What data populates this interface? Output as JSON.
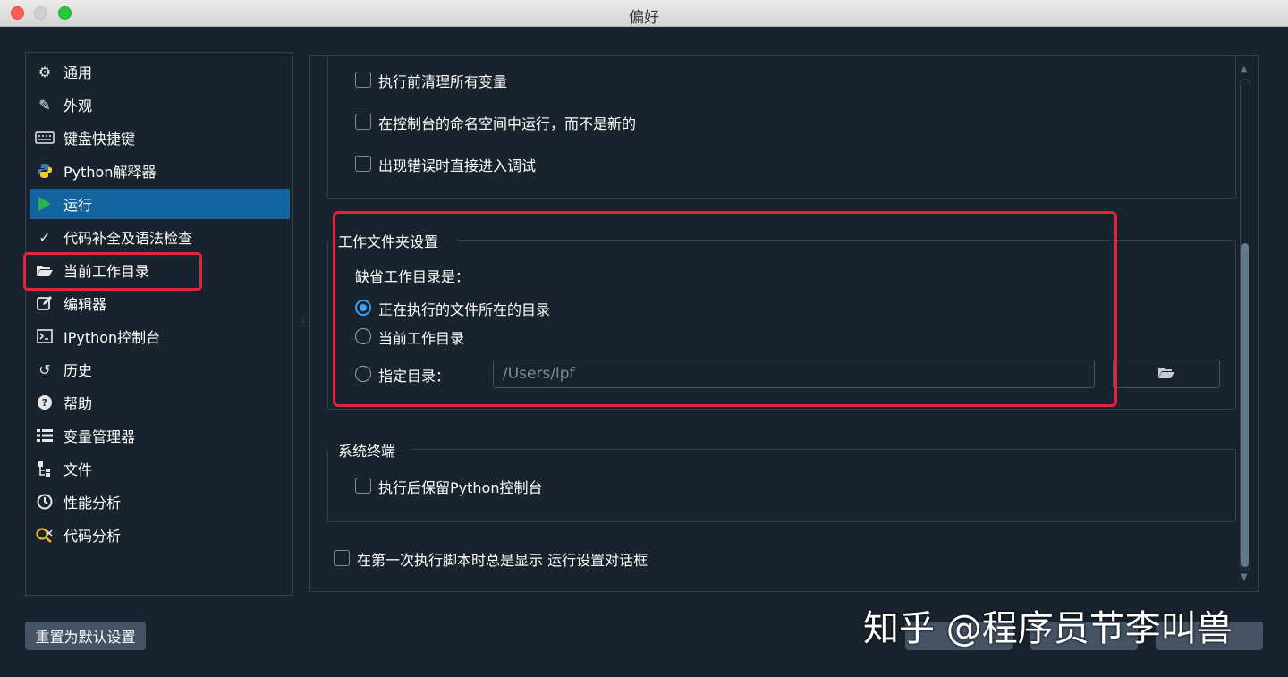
{
  "window": {
    "title": "偏好"
  },
  "sidebar": {
    "items": [
      {
        "label": "通用",
        "icon": "gears-icon"
      },
      {
        "label": "外观",
        "icon": "eyedropper-icon"
      },
      {
        "label": "键盘快捷键",
        "icon": "keyboard-icon"
      },
      {
        "label": "Python解释器",
        "icon": "python-icon"
      },
      {
        "label": "运行",
        "icon": "play-icon",
        "active": true
      },
      {
        "label": "代码补全及语法检查",
        "icon": "code-check-icon"
      },
      {
        "label": "当前工作目录",
        "icon": "folder-open-icon"
      },
      {
        "label": "编辑器",
        "icon": "edit-icon"
      },
      {
        "label": "IPython控制台",
        "icon": "terminal-icon"
      },
      {
        "label": "历史",
        "icon": "history-icon"
      },
      {
        "label": "帮助",
        "icon": "help-icon"
      },
      {
        "label": "变量管理器",
        "icon": "list-icon"
      },
      {
        "label": "文件",
        "icon": "file-tree-icon"
      },
      {
        "label": "性能分析",
        "icon": "clock-icon"
      },
      {
        "label": "代码分析",
        "icon": "code-analysis-icon"
      }
    ],
    "accent_color": "#1464a0"
  },
  "general_options": {
    "clear_vars": "执行前清理所有变量",
    "run_in_namespace": "在控制台的命名空间中运行，而不是新的",
    "debug_on_error": "出现错误时直接进入调试"
  },
  "working_dir": {
    "group_title": "工作文件夹设置",
    "prompt": "缺省工作目录是：",
    "option_script_dir": "正在执行的文件所在的目录",
    "option_current_dir": "当前工作目录",
    "option_fixed_dir": "指定目录：",
    "path_value": "/Users/lpf",
    "selected": "option_script_dir"
  },
  "system_terminal": {
    "group_title": "系统终端",
    "keep_console": "执行后保留Python控制台"
  },
  "always_show_dialog": "在第一次执行脚本时总是显示 运行设置对话框",
  "buttons": {
    "reset": "重置为默认设置"
  },
  "watermark": "知乎 @程序员节李叫兽",
  "highlight_color": "#e1243a"
}
